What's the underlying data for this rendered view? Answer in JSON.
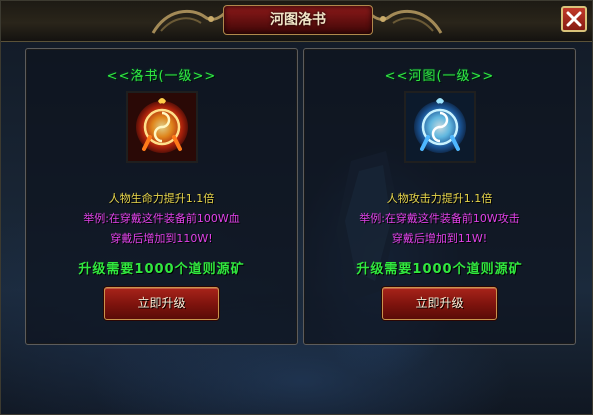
{
  "window": {
    "title": "河图洛书",
    "close_icon": "close-x-icon"
  },
  "panels": [
    {
      "title": "<<洛书(一级>>",
      "icon": "luoshu-fire-emblem-icon",
      "effect": "人物生命力提升1.1倍",
      "example": "举例:在穿戴这件装备前100W血",
      "example_result": "穿戴后增加到110W!",
      "requirement": "升级需要1000个道则源矿",
      "button_label": "立即升级"
    },
    {
      "title": "<<河图(一级>>",
      "icon": "hetu-ice-emblem-icon",
      "effect": "人物攻击力提升1.1倍",
      "example": "举例:在穿戴这件装备前10W攻击",
      "example_result": "穿戴后增加到11W!",
      "requirement": "升级需要1000个道则源矿",
      "button_label": "立即升级"
    }
  ],
  "colors": {
    "title_green": "#31e83f",
    "effect_yellow": "#e8d64a",
    "example_magenta": "#e041e8",
    "button_red": "#8c1a12"
  }
}
